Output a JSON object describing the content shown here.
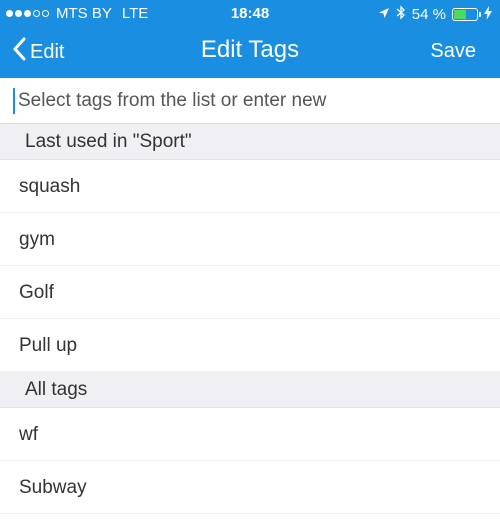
{
  "status_bar": {
    "carrier": "MTS BY",
    "network": "LTE",
    "time": "18:48",
    "battery": "54 %",
    "battery_level": 0.54,
    "signal_dots_filled": 3,
    "signal_dots_total": 5
  },
  "nav": {
    "back_label": "Edit",
    "title": "Edit Tags",
    "save_label": "Save"
  },
  "search": {
    "placeholder": "Select tags from the list or enter new",
    "value": ""
  },
  "sections": {
    "recent": {
      "header": "Last used in \"Sport\"",
      "items": [
        "squash",
        "gym",
        "Golf",
        "Pull up"
      ]
    },
    "all": {
      "header": "All tags",
      "items": [
        "wf",
        "Subway"
      ]
    }
  },
  "colors": {
    "accent": "#1a8ee1",
    "section_bg": "#efeff4",
    "battery_fill": "#4cd964"
  }
}
